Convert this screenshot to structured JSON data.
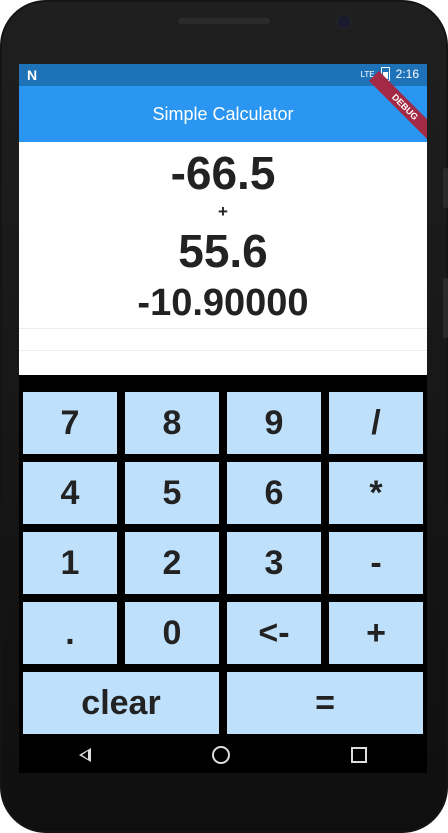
{
  "status": {
    "network": "N",
    "lte": "LTE",
    "time": "2:16"
  },
  "app": {
    "title": "Simple Calculator",
    "debug": "DEBUG"
  },
  "display": {
    "operand1": "-66.5",
    "operator": "+",
    "operand2": "55.6",
    "result": "-10.90000"
  },
  "keys": {
    "k7": "7",
    "k8": "8",
    "k9": "9",
    "kdiv": "/",
    "k4": "4",
    "k5": "5",
    "k6": "6",
    "kmul": "*",
    "k1": "1",
    "k2": "2",
    "k3": "3",
    "ksub": "-",
    "kdot": ".",
    "k0": "0",
    "kback": "<-",
    "kadd": "+",
    "kclear": "clear",
    "keq": "="
  },
  "colors": {
    "app_bar": "#2a96f2",
    "key": "#bfe0fb",
    "status_bar": "#1e73b8",
    "debug_ribbon": "#a32a44"
  }
}
